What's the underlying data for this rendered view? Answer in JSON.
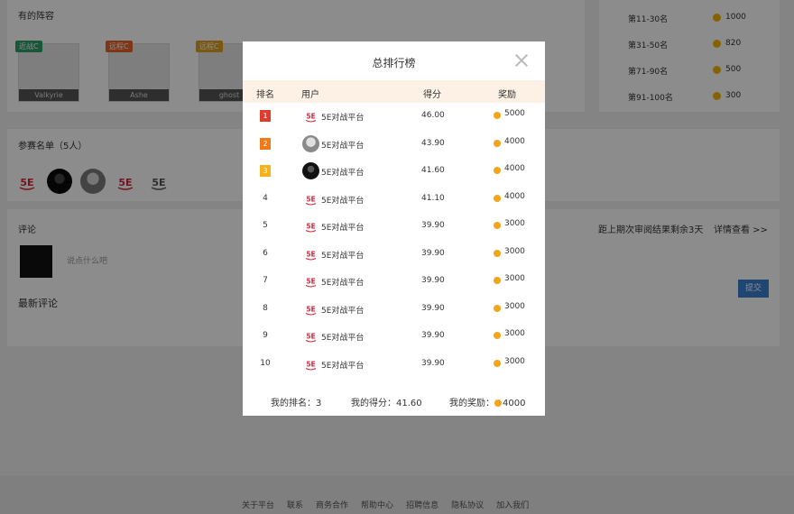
{
  "background": {
    "hero": {
      "title": "有的阵容",
      "cards": [
        {
          "tag": "近战C",
          "tag_color": "#2e9e6a",
          "caption": "Valkyrie"
        },
        {
          "tag": "远程C",
          "tag_color": "#e8632a",
          "caption": "Ashe"
        },
        {
          "tag": "远程C",
          "tag_color": "#e0a020",
          "caption": "ghost"
        }
      ]
    },
    "rank_rewards": [
      {
        "label": "第11-30名",
        "value": "1000"
      },
      {
        "label": "第31-50名",
        "value": "820"
      },
      {
        "label": "第71-90名",
        "value": "500"
      },
      {
        "label": "第91-100名",
        "value": "300"
      }
    ],
    "participants": {
      "title": "参赛名单（5人）"
    },
    "comments": {
      "title": "评论",
      "deadline": "距上期次审阅结果剩余3天",
      "detail_link": "详情查看 >>",
      "input_placeholder": "说点什么吧",
      "latest_title": "最新评论",
      "submit_label": "提交"
    },
    "footer_links": [
      "关于平台",
      "联系",
      "商务合作",
      "帮助中心",
      "招聘信息",
      "隐私协议",
      "加入我们"
    ]
  },
  "modal": {
    "title": "总排行榜",
    "columns": [
      "排名",
      "用户",
      "得分",
      "奖励"
    ],
    "rows": [
      {
        "rank": "1",
        "medal_color": "#e03c2b",
        "avatar": "logo",
        "user": "5E对战平台",
        "score": "46.00",
        "reward": "5000"
      },
      {
        "rank": "2",
        "medal_color": "#f07a18",
        "avatar": "gray",
        "user": "5E对战平台",
        "score": "43.90",
        "reward": "4000"
      },
      {
        "rank": "3",
        "medal_color": "#f6b21b",
        "avatar": "dark",
        "user": "5E对战平台",
        "score": "41.60",
        "reward": "4000"
      },
      {
        "rank": "4",
        "avatar": "logo",
        "user": "5E对战平台",
        "score": "41.10",
        "reward": "4000"
      },
      {
        "rank": "5",
        "avatar": "logo",
        "user": "5E对战平台",
        "score": "39.90",
        "reward": "3000"
      },
      {
        "rank": "6",
        "avatar": "logo",
        "user": "5E对战平台",
        "score": "39.90",
        "reward": "3000"
      },
      {
        "rank": "7",
        "avatar": "logo",
        "user": "5E对战平台",
        "score": "39.90",
        "reward": "3000"
      },
      {
        "rank": "8",
        "avatar": "logo",
        "user": "5E对战平台",
        "score": "39.90",
        "reward": "3000"
      },
      {
        "rank": "9",
        "avatar": "logo",
        "user": "5E对战平台",
        "score": "39.90",
        "reward": "3000"
      },
      {
        "rank": "10",
        "avatar": "logo",
        "user": "5E对战平台",
        "score": "39.90",
        "reward": "3000"
      }
    ],
    "footer": {
      "my_rank": "我的排名：3",
      "my_score": "我的得分：41.60",
      "my_reward_label": "我的奖励：",
      "my_reward_value": "4000"
    }
  }
}
